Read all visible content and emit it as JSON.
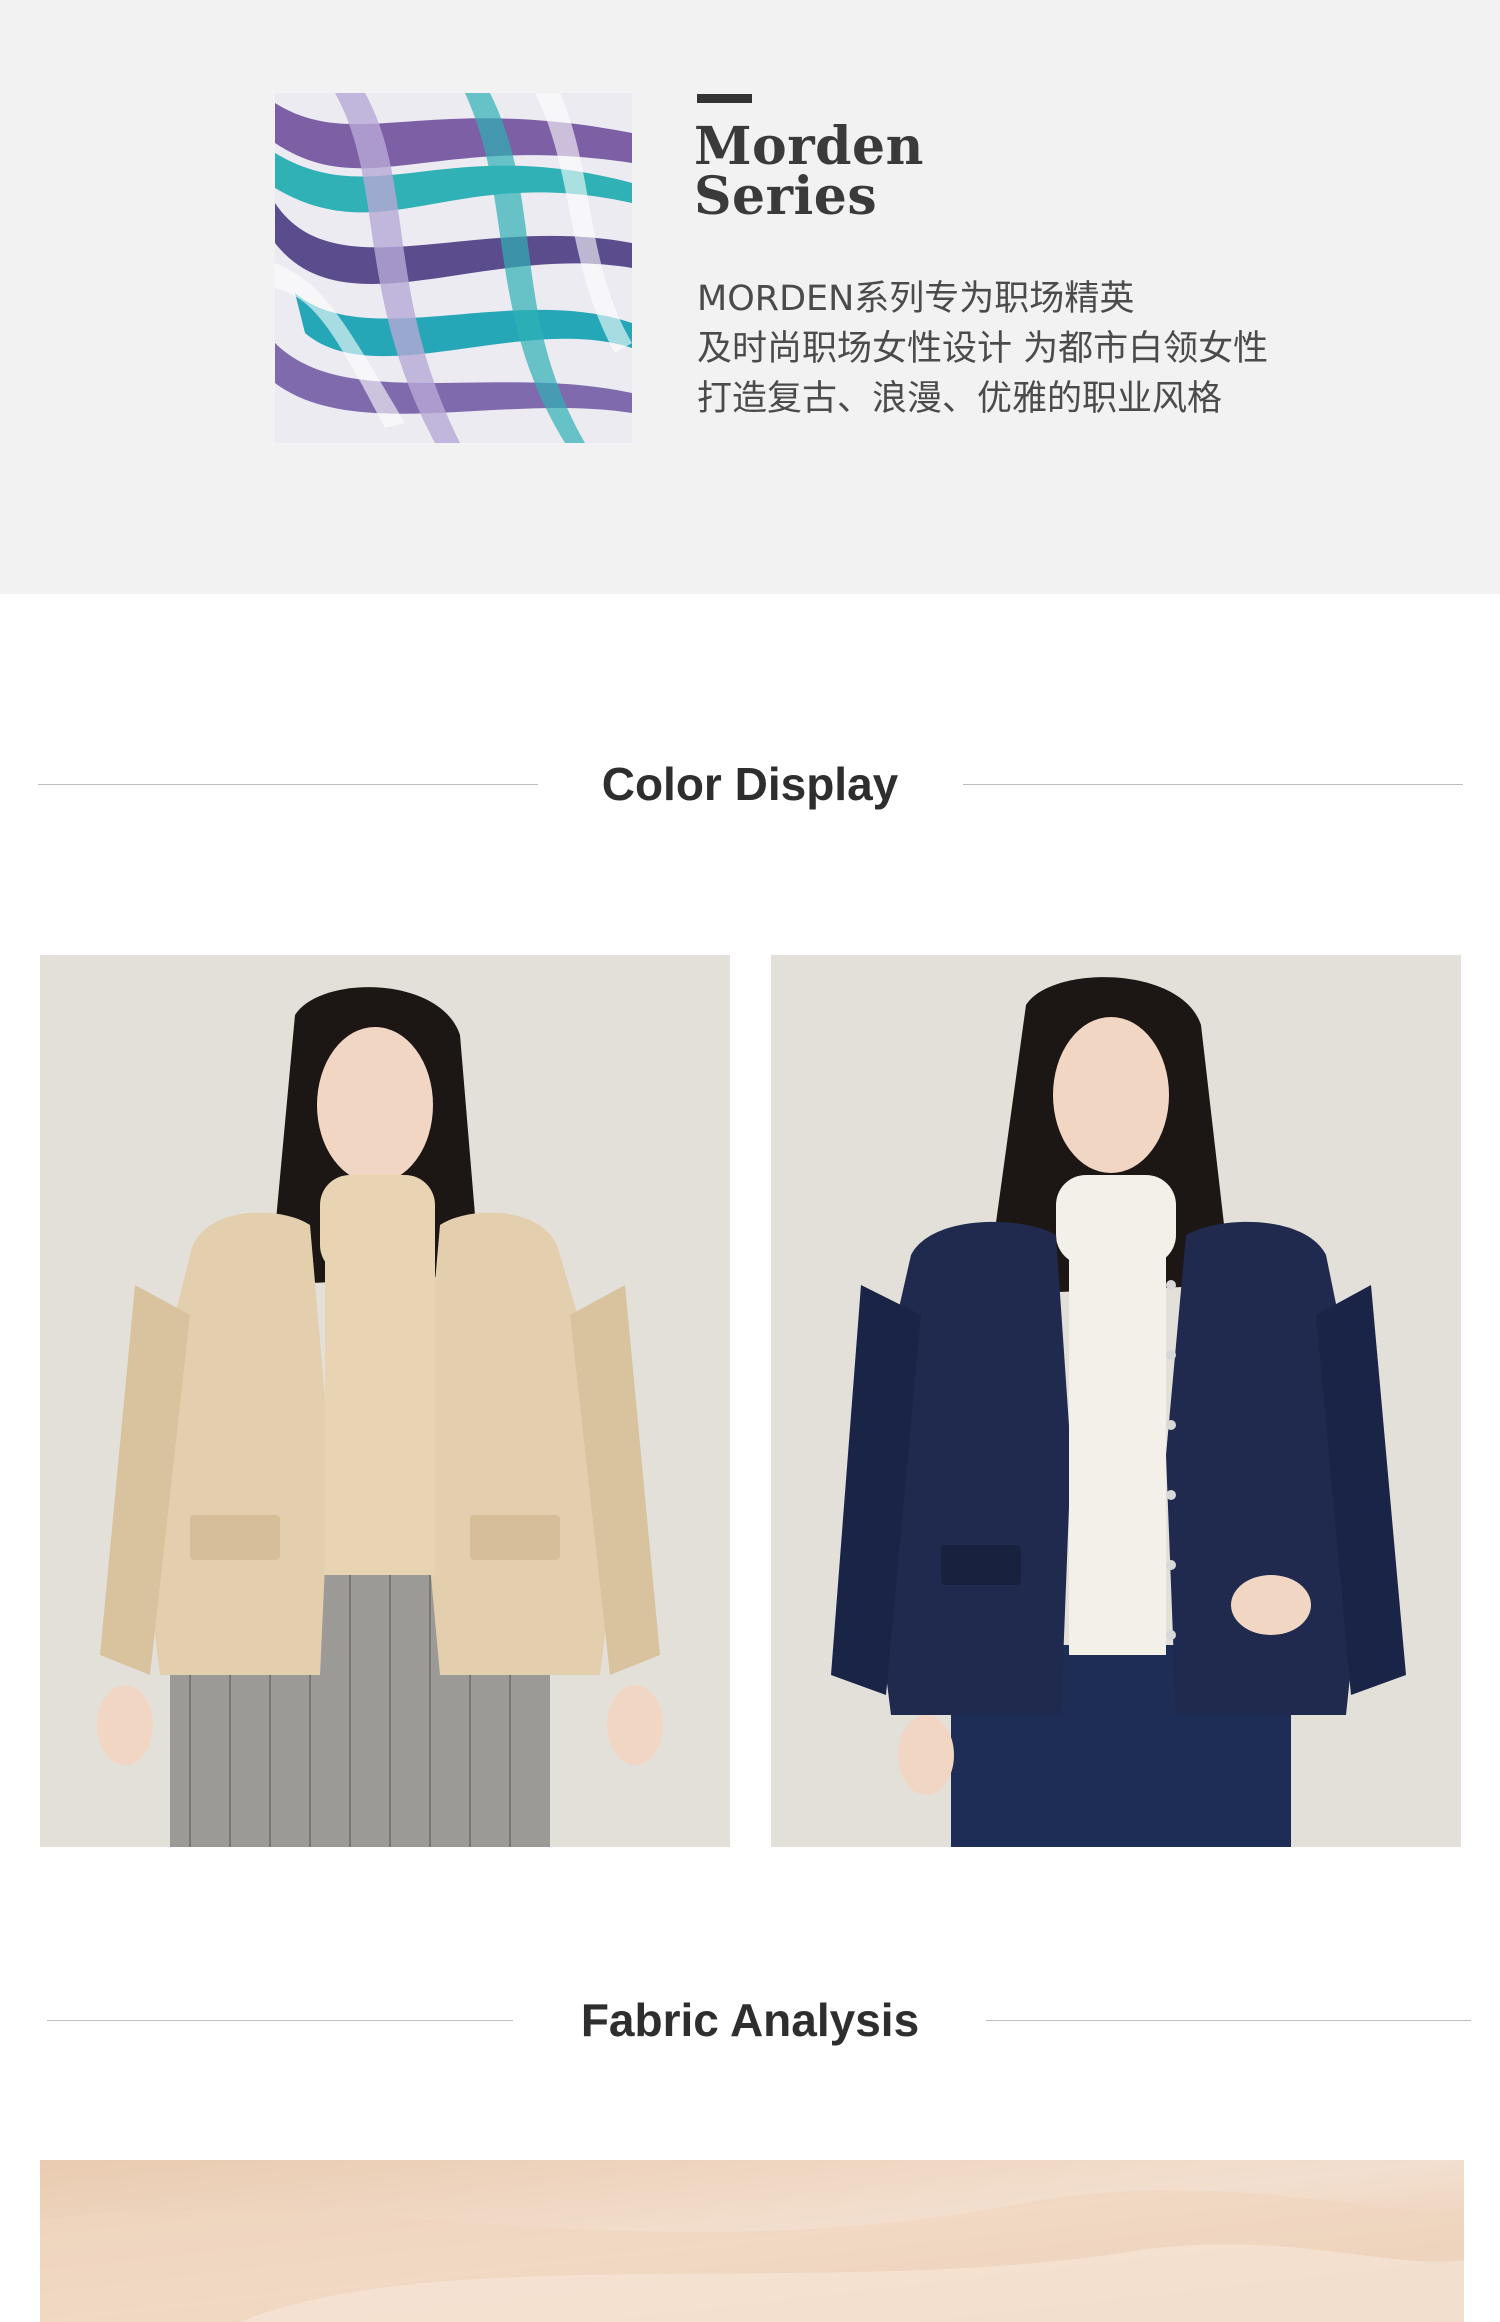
{
  "series": {
    "title_line1": "Morden",
    "title_line2": "Series",
    "desc_line1": "MORDEN系列专为职场精英",
    "desc_line2": "及时尚职场女性设计  为都市白领女性",
    "desc_line3": "打造复古、浪漫、优雅的职业风格"
  },
  "color_display": {
    "heading": "Color Display",
    "items": [
      {
        "name": "beige",
        "jacket_color": "#e3cfae"
      },
      {
        "name": "navy",
        "jacket_color": "#1f2a4e"
      }
    ]
  },
  "fabric_analysis": {
    "heading": "Fabric Analysis"
  },
  "colors": {
    "band_bg": "#f2f2f2",
    "text_dark": "#333333",
    "rule": "#bdbdbd"
  }
}
